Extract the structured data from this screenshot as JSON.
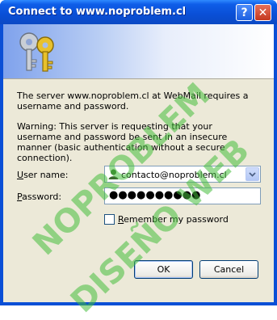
{
  "window": {
    "title": "Connect to www.noproblem.cl",
    "help_label": "?",
    "close_label": "✕"
  },
  "banner": {
    "icon": "keys-icon"
  },
  "message": {
    "intro": "The server www.noproblem.cl at WebMail requires a username and password.",
    "warning": "Warning: This server is requesting that your username and password be sent in an insecure manner (basic authentication without a secure connection)."
  },
  "form": {
    "user_label_u": "U",
    "user_label_rest": "ser name:",
    "user_value": "contacto@noproblem.cl",
    "pass_label_u": "P",
    "pass_label_rest": "assword:",
    "pass_value": "●●●●●●●●●●",
    "remember_u": "R",
    "remember_rest": "emember my password",
    "remember_checked": false
  },
  "buttons": {
    "ok": "OK",
    "cancel": "Cancel"
  },
  "watermark": {
    "line1": "NOPROBLEM",
    "line2": "DISEÑO WEB"
  },
  "colors": {
    "titlebar": "#0a4fd6",
    "client": "#ece9d8",
    "watermark": "#46be3c"
  }
}
